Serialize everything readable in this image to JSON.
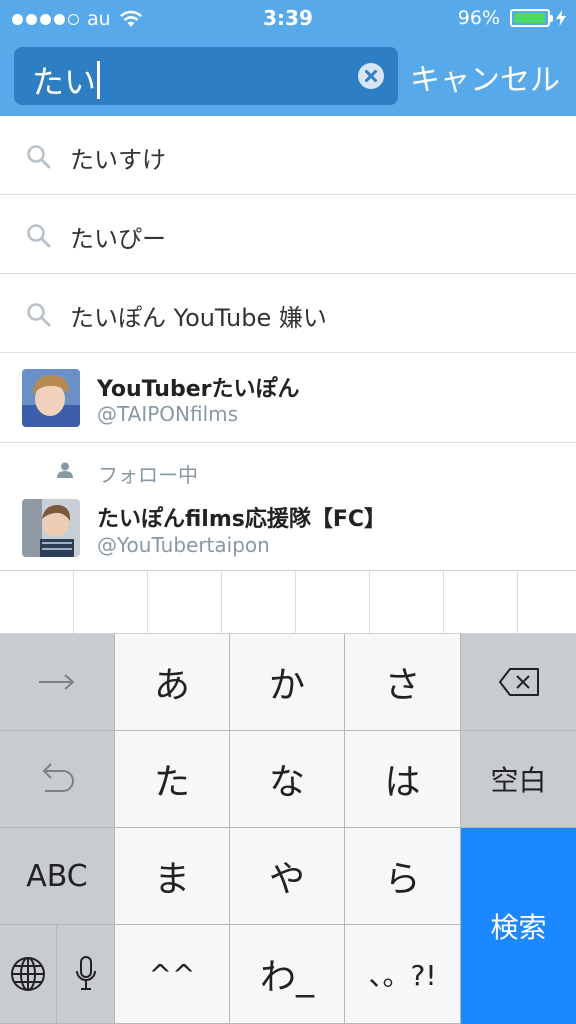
{
  "status_bar": {
    "carrier": "au",
    "time": "3:39",
    "battery_percent_text": "96%",
    "battery_level": 0.96,
    "signal_dots_filled": 4,
    "signal_dots_total": 5
  },
  "search": {
    "query": "たい",
    "cancel_label": "キャンセル"
  },
  "suggestions": [
    {
      "text": "たいすけ"
    },
    {
      "text": "たいぴー"
    },
    {
      "text": "たいぽん YouTube 嫌い"
    }
  ],
  "users": [
    {
      "name": "YouTuberたいぽん",
      "handle": "@TAIPONfilms"
    },
    {
      "following_label": "フォロー中",
      "name": "たいぽんfilms応援隊【FC】",
      "handle": "@YouTubertaipon"
    }
  ],
  "keyboard": {
    "row1": [
      "→",
      "あ",
      "か",
      "さ",
      "backspace"
    ],
    "row2": [
      "undo",
      "た",
      "な",
      "は",
      "空白"
    ],
    "row3": [
      "ABC",
      "ま",
      "や",
      "ら"
    ],
    "row4": [
      "globe",
      "mic",
      "^^",
      "わ_",
      "、。?!"
    ],
    "return_label": "検索"
  },
  "colors": {
    "header": "#57a9ea",
    "search_field": "#2d7ec2",
    "battery": "#4cd964",
    "search_key": "#1b88ff"
  }
}
